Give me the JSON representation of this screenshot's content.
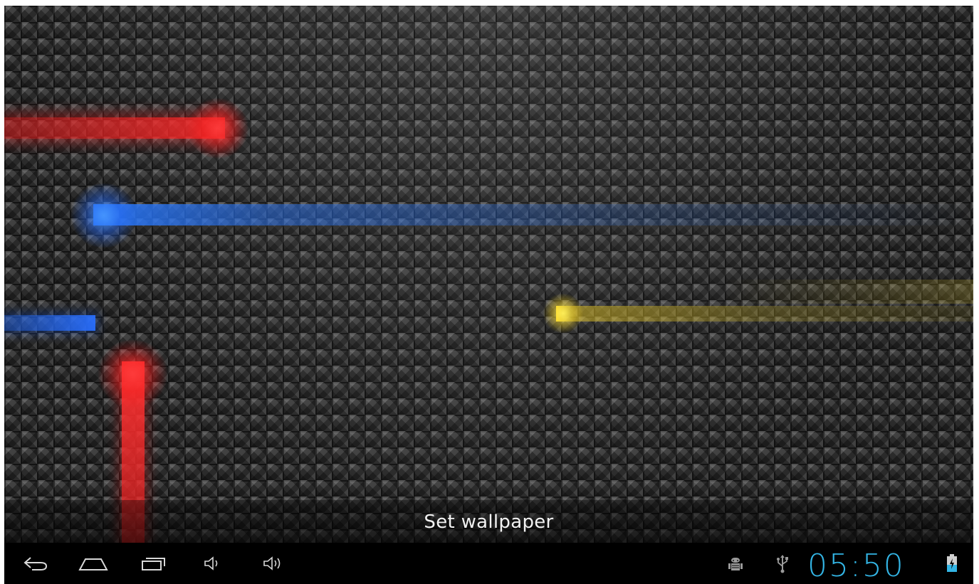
{
  "wallpaper": {
    "name": "live-wallpaper-preview",
    "streak_colors": {
      "red": "#ff2a2a",
      "blue": "#2e78ff",
      "yellow": "#ffdc28"
    }
  },
  "set_wallpaper": {
    "label": "Set wallpaper"
  },
  "status_bar": {
    "clock": "05:50",
    "clock_color": "#33b5e5",
    "icons": [
      "debug-android-icon",
      "usb-icon",
      "battery-charging-icon"
    ]
  },
  "nav_bar": {
    "buttons": [
      "back-icon",
      "home-icon",
      "recent-apps-icon",
      "volume-down-icon",
      "volume-up-icon"
    ]
  }
}
